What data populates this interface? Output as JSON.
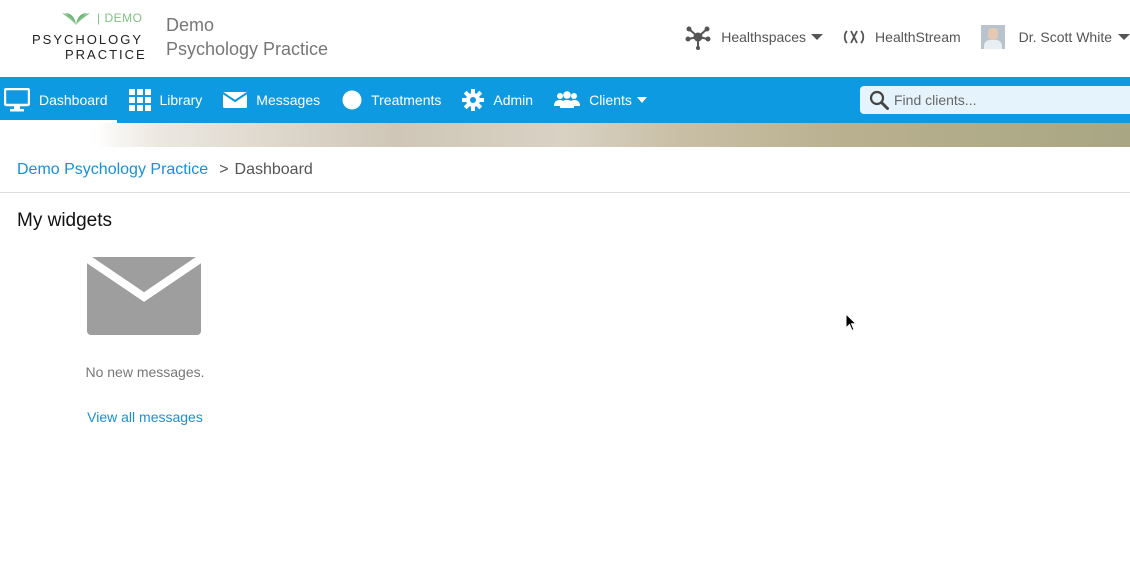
{
  "logo": {
    "demo_tag": "| DEMO",
    "line1": "PSYCHOLOGY",
    "line2": "PRACTICE"
  },
  "practice": {
    "name_line1": "Demo",
    "name_line2": "Psychology Practice"
  },
  "topbar": {
    "healthspaces_label": "Healthspaces",
    "healthstream_label": "HealthStream",
    "user_name": "Dr. Scott White"
  },
  "nav": {
    "items": [
      {
        "label": "Dashboard",
        "icon": "monitor-icon",
        "active": true
      },
      {
        "label": "Library",
        "icon": "grid-icon"
      },
      {
        "label": "Messages",
        "icon": "envelope-icon"
      },
      {
        "label": "Treatments",
        "icon": "circle-icon"
      },
      {
        "label": "Admin",
        "icon": "gear-icon"
      },
      {
        "label": "Clients",
        "icon": "users-icon",
        "dropdown": true
      }
    ]
  },
  "search": {
    "placeholder": "Find clients..."
  },
  "breadcrumb": {
    "root": "Demo Psychology Practice",
    "separator": ">",
    "current": "Dashboard"
  },
  "widgets": {
    "title": "My widgets",
    "messages": {
      "status": "No new messages.",
      "link": "View all messages"
    }
  },
  "colors": {
    "primary_blue": "#0d9ae0",
    "link_blue": "#1a8fd6",
    "logo_green": "#7dc383",
    "icon_gray": "#9e9e9e"
  }
}
